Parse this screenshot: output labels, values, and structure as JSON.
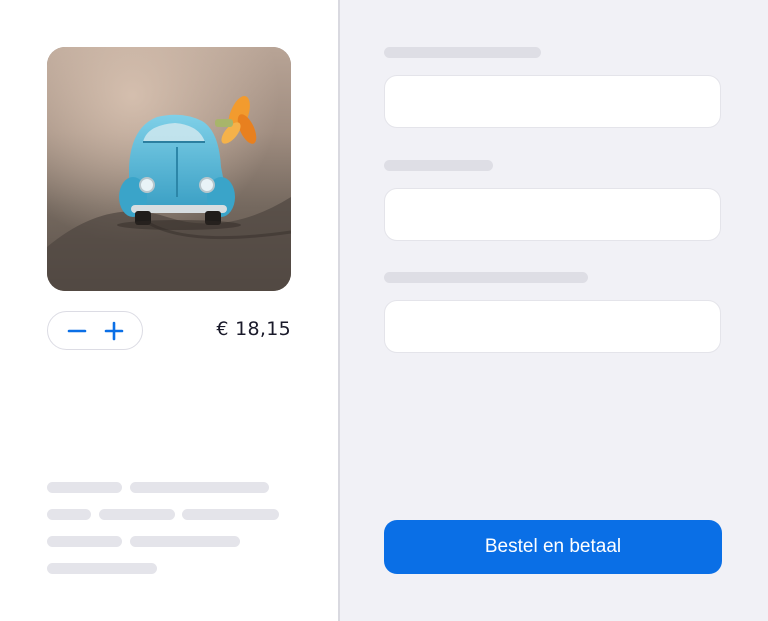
{
  "product": {
    "image_alt": "Blue toy car",
    "price": "€ 18,15",
    "stepper": {
      "decrement_icon": "minus-icon",
      "increment_icon": "plus-icon"
    }
  },
  "form": {
    "fields": [
      {
        "value": "",
        "placeholder": ""
      },
      {
        "value": "",
        "placeholder": ""
      },
      {
        "value": "",
        "placeholder": ""
      }
    ],
    "submit_label": "Bestel en betaal"
  },
  "colors": {
    "accent": "#0a6fe6",
    "panel_bg": "#f1f1f6",
    "skeleton": "#e4e4ea"
  }
}
